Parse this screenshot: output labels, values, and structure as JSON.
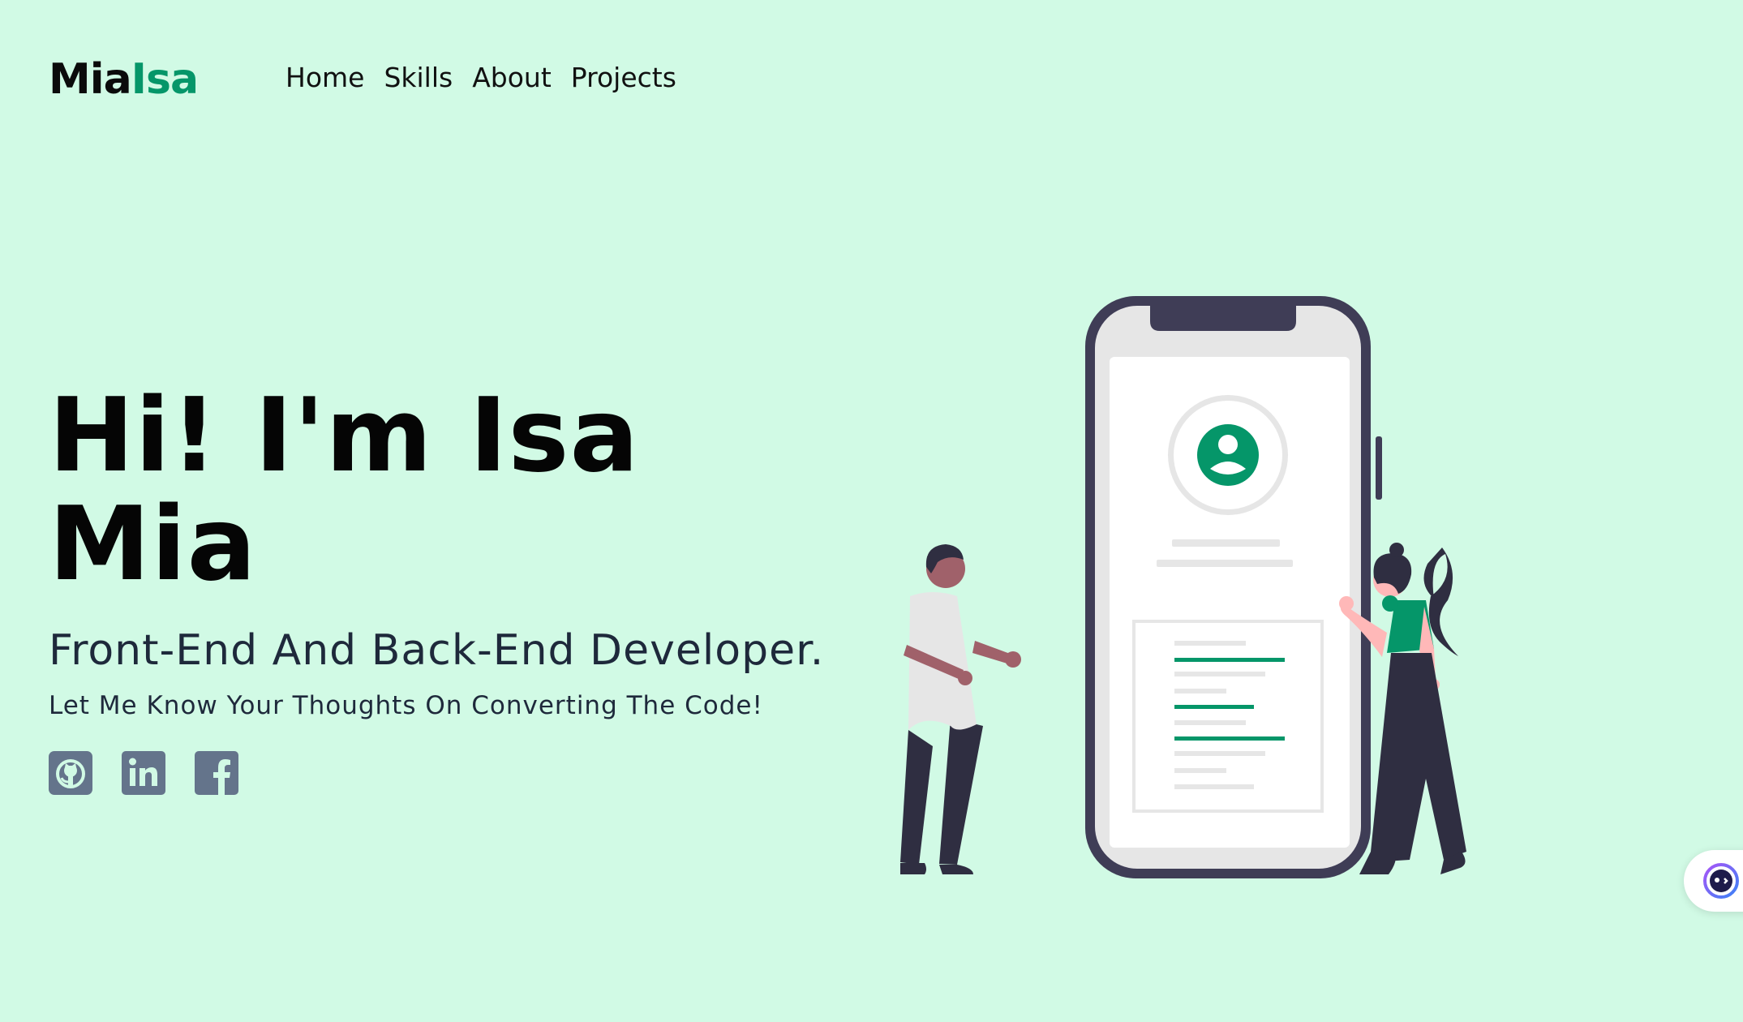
{
  "logo": {
    "first": "Mia",
    "last": "Isa"
  },
  "nav": {
    "items": [
      "Home",
      "Skills",
      "About",
      "Projects"
    ]
  },
  "hero": {
    "title_line1": "Hi! I'm Isa",
    "title_line2": "Mia",
    "subtitle": "Front-End And Back-End Developer.",
    "note": "Let Me Know Your Thoughts On Converting The Code!"
  },
  "socials": [
    {
      "icon": "github-icon"
    },
    {
      "icon": "linkedin-icon"
    },
    {
      "icon": "facebook-icon"
    }
  ],
  "colors": {
    "background": "#d1fae5",
    "accent": "#059669",
    "social_icon": "#64748b",
    "phone_frame": "#3f3d56"
  },
  "chat_widget": {
    "icon": "chat-bot-icon"
  }
}
